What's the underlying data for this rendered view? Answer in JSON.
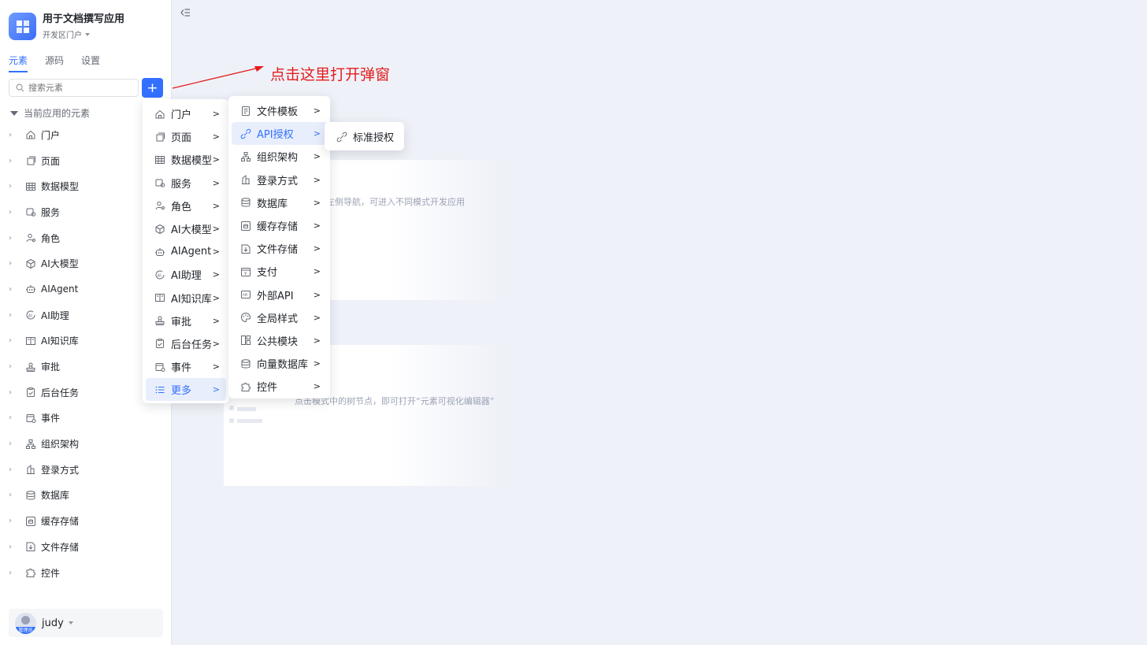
{
  "app": {
    "title": "用于文档撰写应用",
    "portal": "开发区门户"
  },
  "tabs": [
    "元素",
    "源码",
    "设置"
  ],
  "search": {
    "placeholder": "搜索元素"
  },
  "add_label": "+",
  "tree": {
    "header": "当前应用的元素",
    "items": [
      {
        "label": "门户",
        "icon": "home-icon"
      },
      {
        "label": "页面",
        "icon": "page-icon"
      },
      {
        "label": "数据模型",
        "icon": "table-icon"
      },
      {
        "label": "服务",
        "icon": "service-icon"
      },
      {
        "label": "角色",
        "icon": "role-icon"
      },
      {
        "label": "AI大模型",
        "icon": "ai-model-icon"
      },
      {
        "label": "AIAgent",
        "icon": "robot-icon"
      },
      {
        "label": "AI助理",
        "icon": "ai-assistant-icon"
      },
      {
        "label": "AI知识库",
        "icon": "book-icon"
      },
      {
        "label": "审批",
        "icon": "stamp-icon"
      },
      {
        "label": "后台任务",
        "icon": "task-icon"
      },
      {
        "label": "事件",
        "icon": "event-icon"
      },
      {
        "label": "组织架构",
        "icon": "org-icon"
      },
      {
        "label": "登录方式",
        "icon": "login-icon"
      },
      {
        "label": "数据库",
        "icon": "database-icon"
      },
      {
        "label": "缓存存储",
        "icon": "cache-icon"
      },
      {
        "label": "文件存储",
        "icon": "file-storage-icon"
      },
      {
        "label": "控件",
        "icon": "puzzle-icon"
      }
    ]
  },
  "user": {
    "name": "judy",
    "badge": "管理员"
  },
  "annotation": "点击这里打开弹窗",
  "ghost": {
    "line1": "左侧导航，可进入不同模式开发应用",
    "line2": "点击模式中的树节点，即可打开“元素可视化编辑器”"
  },
  "menu1": {
    "items": [
      {
        "label": "门户",
        "icon": "home-icon"
      },
      {
        "label": "页面",
        "icon": "page-icon"
      },
      {
        "label": "数据模型",
        "icon": "table-icon"
      },
      {
        "label": "服务",
        "icon": "service-icon"
      },
      {
        "label": "角色",
        "icon": "role-icon"
      },
      {
        "label": "AI大模型",
        "icon": "ai-model-icon"
      },
      {
        "label": "AIAgent",
        "icon": "robot-icon"
      },
      {
        "label": "AI助理",
        "icon": "ai-assistant-icon"
      },
      {
        "label": "AI知识库",
        "icon": "book-icon"
      },
      {
        "label": "审批",
        "icon": "stamp-icon"
      },
      {
        "label": "后台任务",
        "icon": "task-icon"
      },
      {
        "label": "事件",
        "icon": "event-icon"
      },
      {
        "label": "更多",
        "icon": "list-icon",
        "active": true
      }
    ]
  },
  "menu2": {
    "items": [
      {
        "label": "文件模板",
        "icon": "template-icon"
      },
      {
        "label": "API授权",
        "icon": "link-icon",
        "active": true
      },
      {
        "label": "组织架构",
        "icon": "org-icon"
      },
      {
        "label": "登录方式",
        "icon": "login-icon"
      },
      {
        "label": "数据库",
        "icon": "database-icon"
      },
      {
        "label": "缓存存储",
        "icon": "cache-icon"
      },
      {
        "label": "文件存储",
        "icon": "file-storage-icon"
      },
      {
        "label": "支付",
        "icon": "pay-icon"
      },
      {
        "label": "外部API",
        "icon": "api-icon"
      },
      {
        "label": "全局样式",
        "icon": "palette-icon"
      },
      {
        "label": "公共模块",
        "icon": "module-icon"
      },
      {
        "label": "向量数据库",
        "icon": "vector-db-icon"
      },
      {
        "label": "控件",
        "icon": "puzzle-icon"
      }
    ]
  },
  "menu3": {
    "items": [
      {
        "label": "标准授权",
        "icon": "link-icon"
      }
    ]
  },
  "colors": {
    "accent": "#3370ff",
    "annotation": "#e21d1d",
    "background": "#eff1f8"
  }
}
